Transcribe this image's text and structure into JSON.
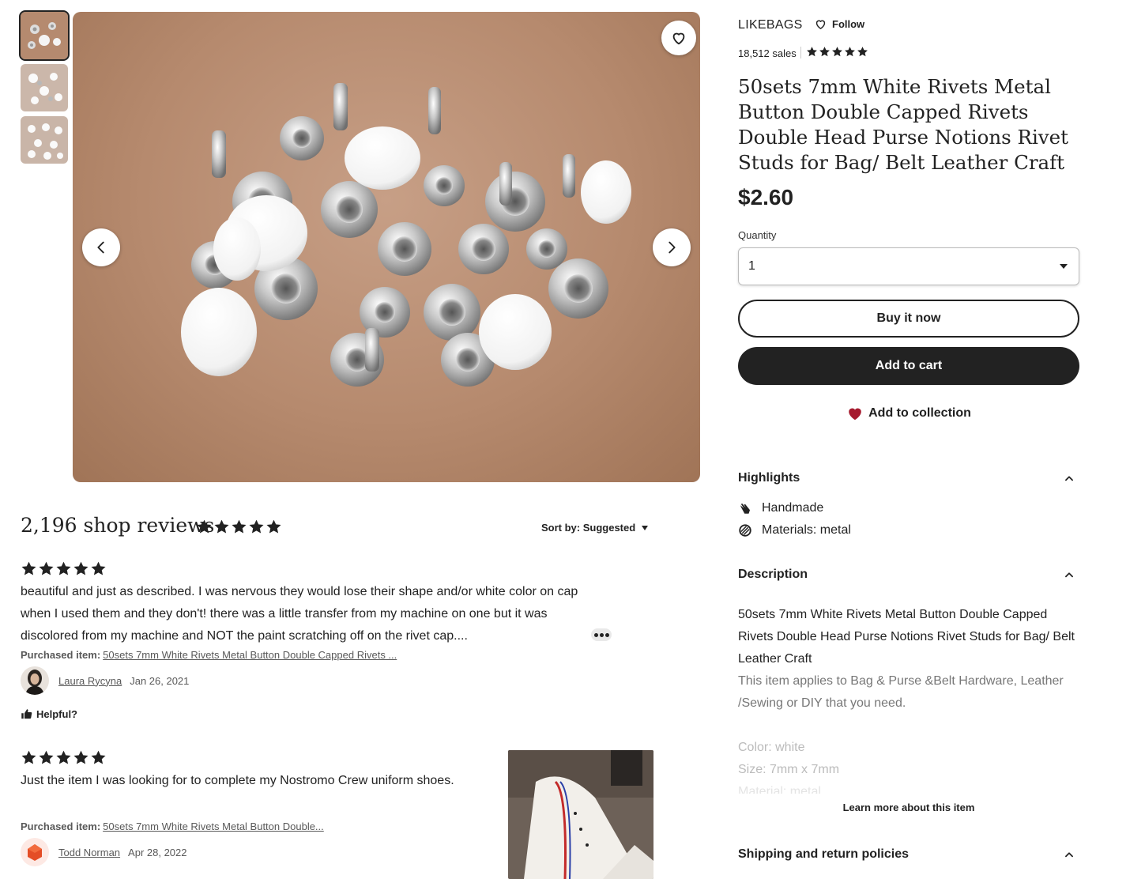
{
  "gallery": {
    "thumbnails": [
      "thumbnail-1",
      "thumbnail-2",
      "thumbnail-3"
    ],
    "selected_index": 0,
    "icons": {
      "favorite": "heart-outline-icon",
      "prev": "chevron-left-icon",
      "next": "chevron-right-icon"
    }
  },
  "shop": {
    "name": "LIKEBAGS",
    "follow_label": "Follow",
    "sales": "18,512 sales",
    "rating": 5
  },
  "product": {
    "title": "50sets 7mm White Rivets Metal Button Double Capped Rivets Double Head Purse Notions Rivet Studs for Bag/ Belt Leather Craft",
    "price": "$2.60",
    "quantity_label": "Quantity",
    "quantity_value": "1",
    "buy_now_label": "Buy it now",
    "add_to_cart_label": "Add to cart",
    "add_to_collection_label": "Add to collection"
  },
  "highlights": {
    "header": "Highlights",
    "items": [
      {
        "icon": "hand-icon",
        "label": "Handmade"
      },
      {
        "icon": "materials-icon",
        "label": "Materials: metal"
      }
    ]
  },
  "description": {
    "header": "Description",
    "lines": [
      "50sets 7mm White Rivets Metal Button Double Capped Rivets Double Head Purse Notions Rivet Studs for Bag/ Belt Leather Craft",
      "This item applies to Bag & Purse &Belt Hardware, Leather /Sewing or DIY that you need.",
      "Color: white",
      "Size: 7mm x 7mm",
      "Material: metal"
    ],
    "learn_more_label": "Learn more about this item"
  },
  "shipping": {
    "header": "Shipping and return policies"
  },
  "reviews": {
    "title": "2,196 shop reviews",
    "rating": 5,
    "sort_label": "Sort by: Suggested",
    "purchased_label": "Purchased item:",
    "helpful_label": "Helpful?",
    "items": [
      {
        "rating": 5,
        "text": "beautiful and just as described. I was nervous they would lose their shape and/or white color on cap when I used them and they don't! there was a little transfer from my machine on one but it was discolored from my machine and NOT the paint scratching off on the rivet cap....",
        "item": "50sets 7mm White Rivets Metal Button Double Capped Rivets ...",
        "reviewer": "Laura Rycyna",
        "date": "Jan 26, 2021"
      },
      {
        "rating": 5,
        "text": "Just the item I was looking for to complete my Nostromo Crew uniform shoes.",
        "item": "50sets 7mm White Rivets Metal Button Double...",
        "reviewer": "Todd Norman",
        "date": "Apr 28, 2022"
      }
    ]
  },
  "colors": {
    "text": "#222222",
    "muted": "#595959",
    "cart_button": "#222222",
    "heart_red": "#a61a2e",
    "rug": "#b68a6e"
  }
}
